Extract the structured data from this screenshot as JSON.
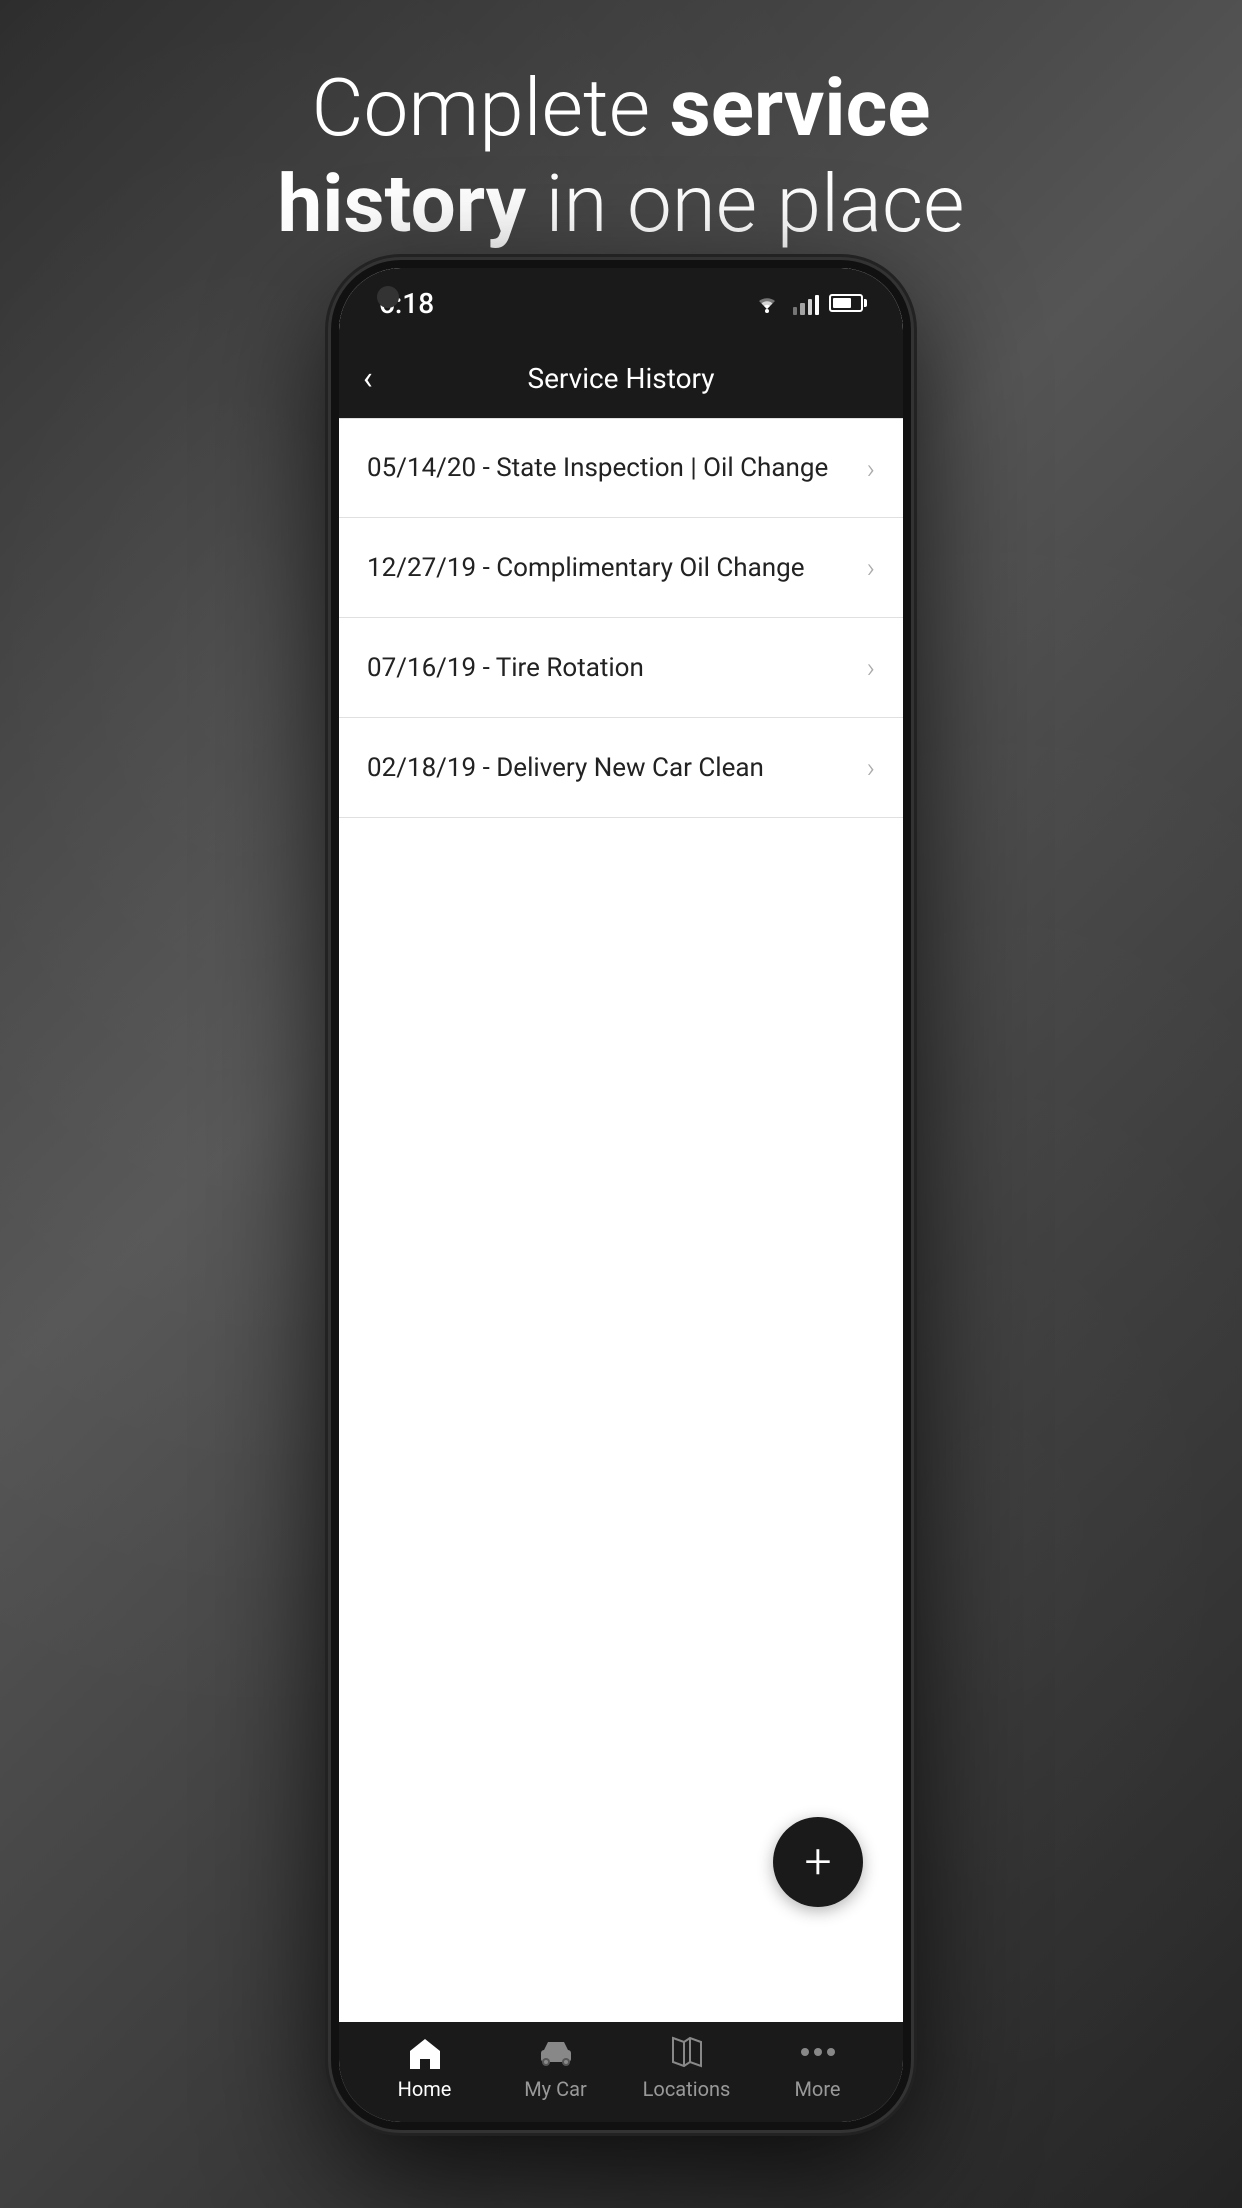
{
  "background": {
    "headline_regular": "Complete ",
    "headline_bold": "service history",
    "headline_regular2": " in one place"
  },
  "status_bar": {
    "time": "6:18",
    "wifi": "wifi",
    "signal": "signal",
    "battery": "battery"
  },
  "header": {
    "back_label": "‹",
    "title": "Service History"
  },
  "service_items": [
    {
      "id": 1,
      "label": "05/14/20 - State Inspection | Oil Change"
    },
    {
      "id": 2,
      "label": "12/27/19 - Complimentary Oil Change"
    },
    {
      "id": 3,
      "label": "07/16/19 - Tire Rotation"
    },
    {
      "id": 4,
      "label": "02/18/19 - Delivery New Car Clean"
    }
  ],
  "fab": {
    "label": "+"
  },
  "nav": {
    "items": [
      {
        "key": "home",
        "label": "Home",
        "active": true
      },
      {
        "key": "mycar",
        "label": "My Car",
        "active": false
      },
      {
        "key": "locations",
        "label": "Locations",
        "active": false
      },
      {
        "key": "more",
        "label": "More",
        "active": false
      }
    ]
  }
}
